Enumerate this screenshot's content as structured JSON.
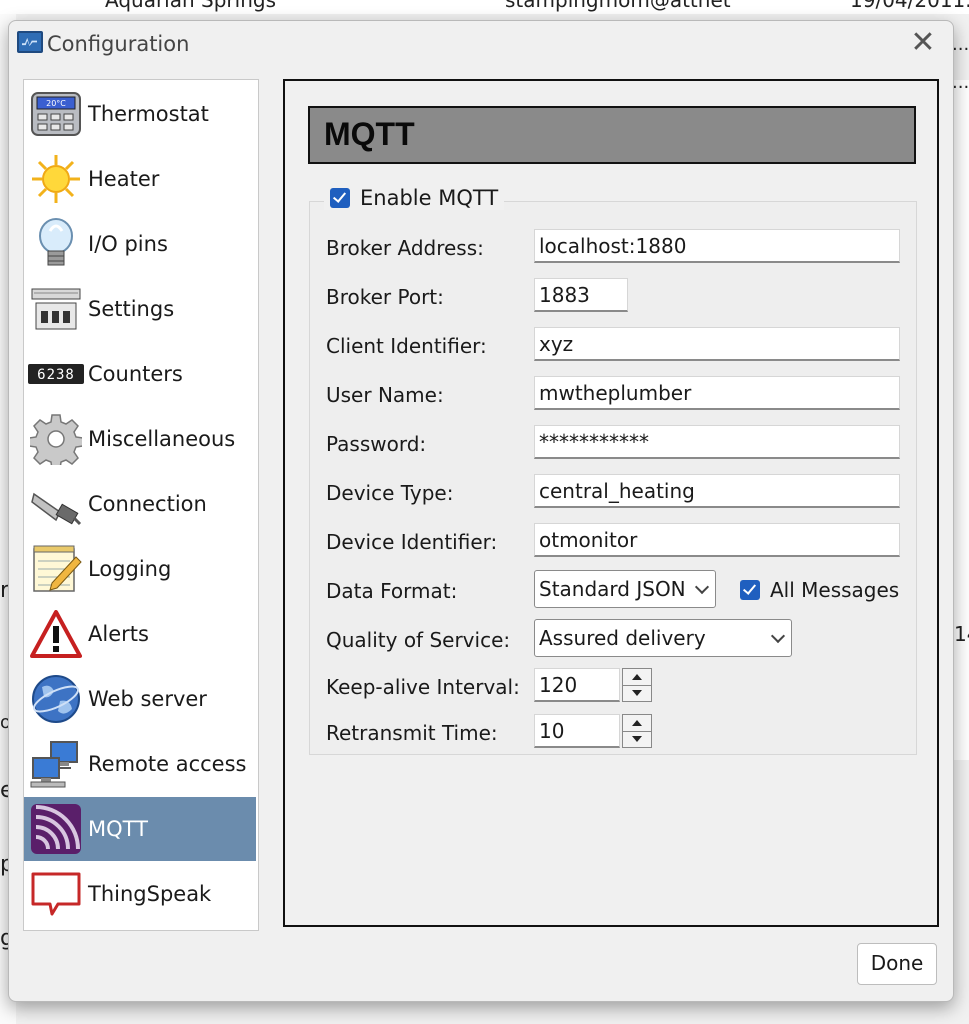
{
  "background": {
    "top_texts": [
      "Aquarian Springs",
      "stampingmom@attnet",
      "19/04/2011..."
    ],
    "fragments": [
      "r",
      "ol",
      "e",
      "p",
      "g",
      "14",
      "..."
    ]
  },
  "window": {
    "title": "Configuration",
    "close_label": "✕"
  },
  "sidebar": {
    "items": [
      {
        "label": "Thermostat",
        "icon": "thermostat-icon"
      },
      {
        "label": "Heater",
        "icon": "sun-icon"
      },
      {
        "label": "I/O pins",
        "icon": "lightbulb-icon"
      },
      {
        "label": "Settings",
        "icon": "switches-icon"
      },
      {
        "label": "Counters",
        "icon": "counter-icon"
      },
      {
        "label": "Miscellaneous",
        "icon": "gear-icon"
      },
      {
        "label": "Connection",
        "icon": "connector-icon"
      },
      {
        "label": "Logging",
        "icon": "notepad-icon"
      },
      {
        "label": "Alerts",
        "icon": "warning-icon"
      },
      {
        "label": "Web server",
        "icon": "globe-icon"
      },
      {
        "label": "Remote access",
        "icon": "computers-icon"
      },
      {
        "label": "MQTT",
        "icon": "mqtt-icon"
      },
      {
        "label": "ThingSpeak",
        "icon": "speech-bubble-icon"
      }
    ],
    "selected_index": 11,
    "counter_digits": "6238",
    "thermostat_display": "20°C"
  },
  "panel": {
    "header": "MQTT",
    "enable_label": "Enable MQTT",
    "enable_checked": true,
    "fields": {
      "broker_address": {
        "label": "Broker Address:",
        "value": "localhost:1880"
      },
      "broker_port": {
        "label": "Broker Port:",
        "value": "1883"
      },
      "client_identifier": {
        "label": "Client Identifier:",
        "value": "xyz"
      },
      "user_name": {
        "label": "User Name:",
        "value": "mwtheplumber"
      },
      "password": {
        "label": "Password:",
        "value": "***********"
      },
      "device_type": {
        "label": "Device Type:",
        "value": "central_heating"
      },
      "device_identifier": {
        "label": "Device Identifier:",
        "value": "otmonitor"
      },
      "data_format": {
        "label": "Data Format:",
        "value": "Standard JSON"
      },
      "quality_of_service": {
        "label": "Quality of Service:",
        "value": "Assured delivery"
      },
      "keepalive": {
        "label": "Keep-alive Interval:",
        "value": "120"
      },
      "retransmit": {
        "label": "Retransmit Time:",
        "value": "10"
      }
    },
    "all_messages": {
      "label": "All Messages",
      "checked": true
    }
  },
  "footer": {
    "done_label": "Done"
  },
  "colors": {
    "selected_bg": "#6b8cad",
    "checkbox": "#1f5fbf",
    "header_bg": "#8a8a8a"
  }
}
